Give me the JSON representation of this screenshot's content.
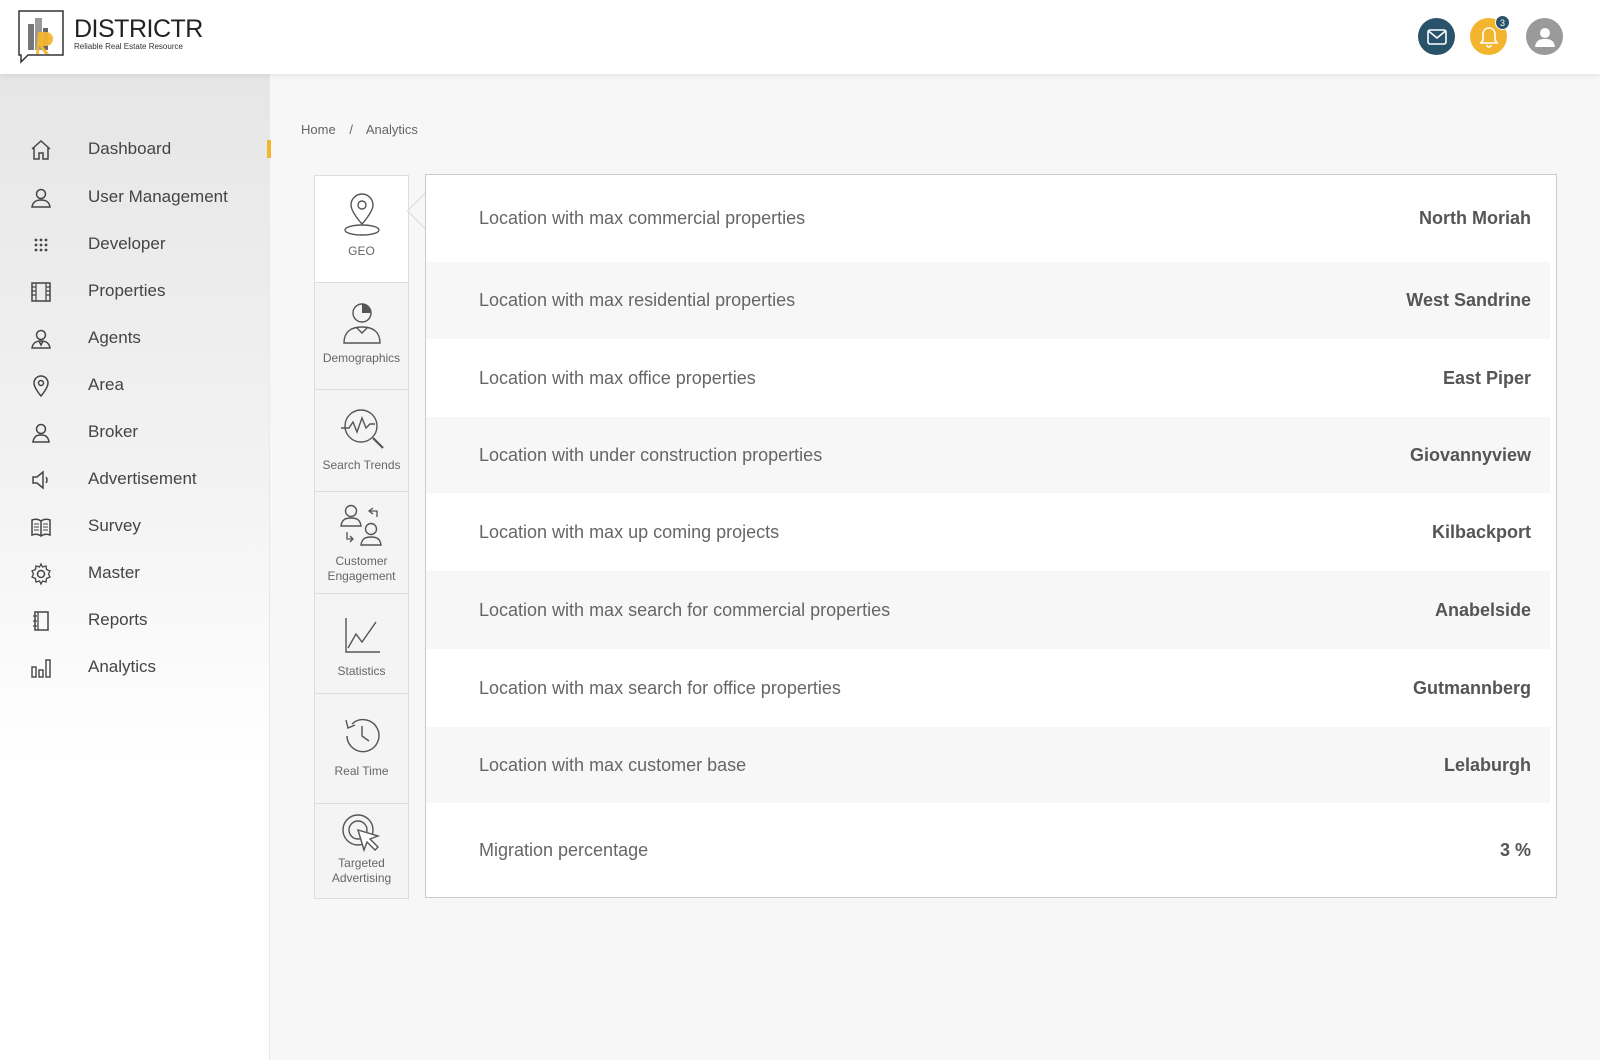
{
  "brand": {
    "name": "DISTRICTR",
    "tagline": "Reliable Real Estate Resource"
  },
  "header": {
    "notifications_count": "3"
  },
  "sidebar": {
    "items": [
      {
        "label": "Dashboard",
        "icon": "home-icon"
      },
      {
        "label": "User Management",
        "icon": "user-icon"
      },
      {
        "label": "Developer",
        "icon": "grid-dots-icon"
      },
      {
        "label": "Properties",
        "icon": "building-icon"
      },
      {
        "label": "Agents",
        "icon": "agent-icon"
      },
      {
        "label": "Area",
        "icon": "map-pin-icon"
      },
      {
        "label": "Broker",
        "icon": "broker-icon"
      },
      {
        "label": "Advertisement",
        "icon": "megaphone-icon"
      },
      {
        "label": "Survey",
        "icon": "book-icon"
      },
      {
        "label": "Master",
        "icon": "gear-icon"
      },
      {
        "label": "Reports",
        "icon": "notebook-icon"
      },
      {
        "label": "Analytics",
        "icon": "bar-chart-icon"
      }
    ],
    "active": "Dashboard"
  },
  "breadcrumb": {
    "home": "Home",
    "separator": "/",
    "current": "Analytics"
  },
  "tabs": [
    {
      "label": "GEO",
      "icon": "geo-pin-icon"
    },
    {
      "label": "Demographics",
      "icon": "demographics-icon"
    },
    {
      "label": "Search Trends",
      "icon": "search-trends-icon"
    },
    {
      "label": "Customer Engagement",
      "icon": "customer-engagement-icon"
    },
    {
      "label": "Statistics",
      "icon": "line-chart-icon"
    },
    {
      "label": "Real Time",
      "icon": "history-clock-icon"
    },
    {
      "label": "Targeted Advertising",
      "icon": "target-cursor-icon"
    }
  ],
  "active_tab": "GEO",
  "geo_rows": [
    {
      "label": "Location with max commercial properties",
      "value": "North Moriah"
    },
    {
      "label": "Location with max residential properties",
      "value": "West Sandrine"
    },
    {
      "label": "Location with max office properties",
      "value": "East Piper"
    },
    {
      "label": "Location with under construction properties",
      "value": "Giovannyview"
    },
    {
      "label": "Location with max up coming projects",
      "value": "Kilbackport"
    },
    {
      "label": "Location with max search for commercial properties",
      "value": "Anabelside"
    },
    {
      "label": "Location with max search for office properties",
      "value": "Gutmannberg"
    },
    {
      "label": "Location with max customer base",
      "value": "Lelaburgh"
    },
    {
      "label": "Migration percentage",
      "value": "3 %"
    }
  ],
  "colors": {
    "accent": "#f4b52e",
    "primary": "#28536b",
    "avatar": "#9a9a9a"
  }
}
